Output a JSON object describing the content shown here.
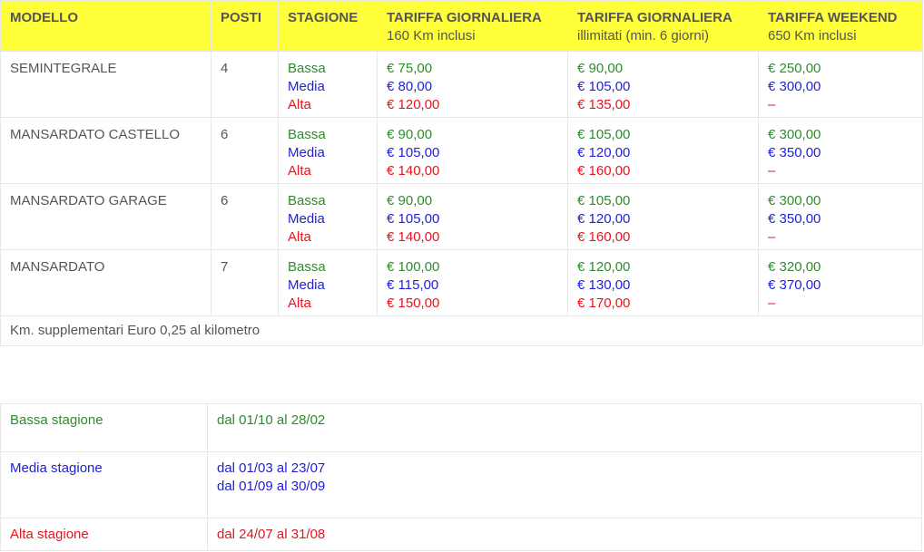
{
  "rates": {
    "headers": {
      "modello": "MODELLO",
      "posti": "POSTI",
      "stagione": "STAGIONE",
      "daily160": {
        "title": "TARIFFA GIORNALIERA",
        "sub": "160 Km inclusi"
      },
      "dailyUnl": {
        "title": "TARIFFA GIORNALIERA",
        "sub": "illimitati (min. 6 giorni)"
      },
      "weekend": {
        "title": "TARIFFA WEEKEND",
        "sub": "650 Km inclusi"
      }
    },
    "season_labels": {
      "bassa": "Bassa",
      "media": "Media",
      "alta": "Alta"
    },
    "rows": [
      {
        "modello": "SEMINTEGRALE",
        "posti": "4",
        "daily160": [
          "€ 75,00",
          "€ 80,00",
          "€ 120,00"
        ],
        "dailyUnl": [
          "€ 90,00",
          "€ 105,00",
          "€ 135,00"
        ],
        "weekend": [
          "€ 250,00",
          "€ 300,00",
          "–"
        ]
      },
      {
        "modello": "MANSARDATO CASTELLO",
        "posti": "6",
        "daily160": [
          "€ 90,00",
          "€ 105,00",
          "€ 140,00"
        ],
        "dailyUnl": [
          "€ 105,00",
          "€ 120,00",
          "€ 160,00"
        ],
        "weekend": [
          "€ 300,00",
          "€ 350,00",
          "–"
        ]
      },
      {
        "modello": "MANSARDATO GARAGE",
        "posti": "6",
        "daily160": [
          "€ 90,00",
          "€ 105,00",
          "€ 140,00"
        ],
        "dailyUnl": [
          "€ 105,00",
          "€ 120,00",
          "€ 160,00"
        ],
        "weekend": [
          "€ 300,00",
          "€ 350,00",
          "–"
        ]
      },
      {
        "modello": "MANSARDATO",
        "posti": "7",
        "daily160": [
          "€ 100,00",
          "€ 115,00",
          "€ 150,00"
        ],
        "dailyUnl": [
          "€ 120,00",
          "€ 130,00",
          "€ 170,00"
        ],
        "weekend": [
          "€ 320,00",
          "€ 370,00",
          "–"
        ]
      }
    ],
    "footer_note": "Km. supplementari Euro 0,25 al kilometro"
  },
  "seasons": {
    "bassa": {
      "label": "Bassa stagione",
      "dates": [
        "dal 01/10 al 28/02"
      ]
    },
    "media": {
      "label": "Media stagione",
      "dates": [
        "dal 01/03 al 23/07",
        "dal 01/09 al 30/09"
      ]
    },
    "alta": {
      "label": "Alta stagione",
      "dates": [
        "dal 24/07 al 31/08"
      ]
    }
  },
  "colors": {
    "header_bg": "#ffff3a",
    "bassa": "#2e8b2e",
    "media": "#1f1fd6",
    "alta": "#e8141e"
  }
}
